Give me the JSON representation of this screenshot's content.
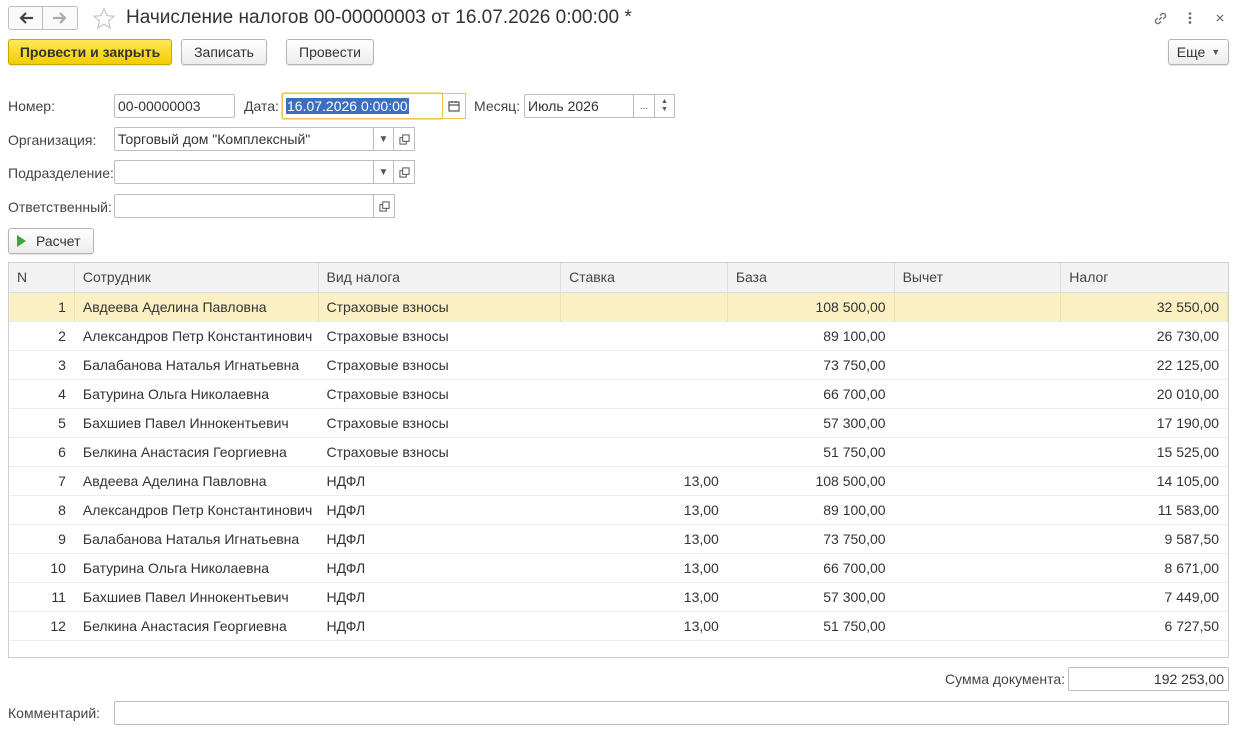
{
  "window": {
    "title": "Начисление налогов 00-00000003 от 16.07.2026 0:00:00 *"
  },
  "toolbar": {
    "post_close_label": "Провести и закрыть",
    "save_label": "Записать",
    "post_label": "Провести",
    "more_label": "Еще"
  },
  "form": {
    "number_label": "Номер:",
    "number_value": "00-00000003",
    "date_label": "Дата:",
    "date_value": "16.07.2026  0:00:00",
    "month_label": "Месяц:",
    "month_value": "Июль 2026",
    "month_choose": "...",
    "org_label": "Организация:",
    "org_value": "Торговый дом \"Комплексный\"",
    "dept_label": "Подразделение:",
    "dept_value": "",
    "resp_label": "Ответственный:",
    "resp_value": "",
    "calc_label": "Расчет"
  },
  "table": {
    "columns": [
      "N",
      "Сотрудник",
      "Вид налога",
      "Ставка",
      "База",
      "Вычет",
      "Налог"
    ],
    "rows": [
      {
        "n": "1",
        "employee": "Авдеева Аделина Павловна",
        "type": "Страховые взносы",
        "rate": "",
        "base": "108 500,00",
        "deduction": "",
        "tax": "32 550,00"
      },
      {
        "n": "2",
        "employee": "Александров Петр Константинович",
        "type": "Страховые взносы",
        "rate": "",
        "base": "89 100,00",
        "deduction": "",
        "tax": "26 730,00"
      },
      {
        "n": "3",
        "employee": "Балабанова Наталья Игнатьевна",
        "type": "Страховые взносы",
        "rate": "",
        "base": "73 750,00",
        "deduction": "",
        "tax": "22 125,00"
      },
      {
        "n": "4",
        "employee": "Батурина Ольга Николаевна",
        "type": "Страховые взносы",
        "rate": "",
        "base": "66 700,00",
        "deduction": "",
        "tax": "20 010,00"
      },
      {
        "n": "5",
        "employee": "Бахшиев Павел Иннокентьевич",
        "type": "Страховые взносы",
        "rate": "",
        "base": "57 300,00",
        "deduction": "",
        "tax": "17 190,00"
      },
      {
        "n": "6",
        "employee": "Белкина Анастасия Георгиевна",
        "type": "Страховые взносы",
        "rate": "",
        "base": "51 750,00",
        "deduction": "",
        "tax": "15 525,00"
      },
      {
        "n": "7",
        "employee": "Авдеева Аделина Павловна",
        "type": "НДФЛ",
        "rate": "13,00",
        "base": "108 500,00",
        "deduction": "",
        "tax": "14 105,00"
      },
      {
        "n": "8",
        "employee": "Александров Петр Константинович",
        "type": "НДФЛ",
        "rate": "13,00",
        "base": "89 100,00",
        "deduction": "",
        "tax": "11 583,00"
      },
      {
        "n": "9",
        "employee": "Балабанова Наталья Игнатьевна",
        "type": "НДФЛ",
        "rate": "13,00",
        "base": "73 750,00",
        "deduction": "",
        "tax": "9 587,50"
      },
      {
        "n": "10",
        "employee": "Батурина Ольга Николаевна",
        "type": "НДФЛ",
        "rate": "13,00",
        "base": "66 700,00",
        "deduction": "",
        "tax": "8 671,00"
      },
      {
        "n": "11",
        "employee": "Бахшиев Павел Иннокентьевич",
        "type": "НДФЛ",
        "rate": "13,00",
        "base": "57 300,00",
        "deduction": "",
        "tax": "7 449,00"
      },
      {
        "n": "12",
        "employee": "Белкина Анастасия Георгиевна",
        "type": "НДФЛ",
        "rate": "13,00",
        "base": "51 750,00",
        "deduction": "",
        "tax": "6 727,50"
      }
    ],
    "active_row": 0
  },
  "footer": {
    "sum_label": "Сумма документа:",
    "sum_value": "192 253,00",
    "comment_label": "Комментарий:",
    "comment_value": ""
  },
  "icons": {
    "back": "arrow-left-icon",
    "forward": "arrow-right-icon",
    "favorite": "star-icon",
    "link": "link-icon",
    "more": "more-vertical-icon",
    "close": "close-icon",
    "dropdown": "chevron-down-icon",
    "open": "open-form-icon",
    "calendar": "calendar-icon",
    "play": "play-icon"
  },
  "colors": {
    "primary_button": "#f3cd00",
    "active_row": "#fbf0c4",
    "selection": "#3a6fc4",
    "focus_border": "#e8c64a"
  }
}
